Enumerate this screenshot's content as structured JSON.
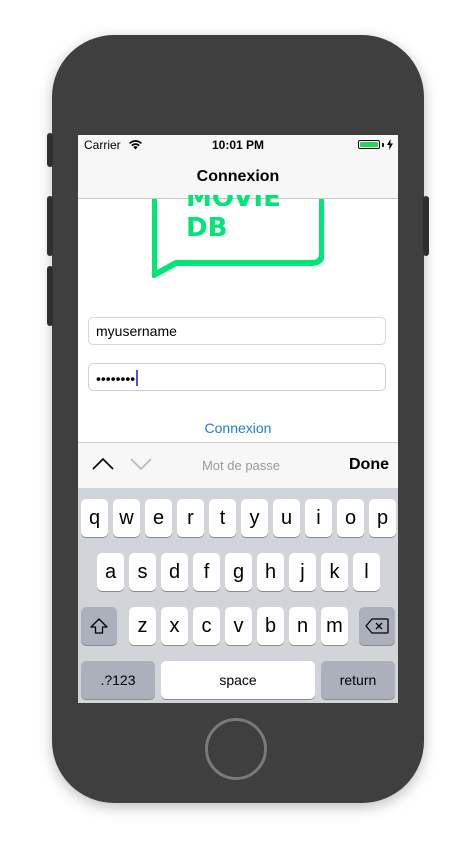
{
  "status_bar": {
    "carrier": "Carrier",
    "time": "10:01 PM"
  },
  "nav": {
    "title": "Connexion"
  },
  "logo": {
    "line1": "MOVIE",
    "line2": "DB",
    "color": "#00e676"
  },
  "form": {
    "username_value": "myusername",
    "password_dots": "••••••••",
    "login_label": "Connexion"
  },
  "toolbar": {
    "field_label": "Mot de passe",
    "done_label": "Done"
  },
  "keyboard": {
    "row1": [
      "q",
      "w",
      "e",
      "r",
      "t",
      "y",
      "u",
      "i",
      "o",
      "p"
    ],
    "row2": [
      "a",
      "s",
      "d",
      "f",
      "g",
      "h",
      "j",
      "k",
      "l"
    ],
    "row3": [
      "z",
      "x",
      "c",
      "v",
      "b",
      "n",
      "m"
    ],
    "numbers_label": ".?123",
    "space_label": "space",
    "return_label": "return",
    "shift_icon": "shift-icon",
    "delete_icon": "delete-icon"
  },
  "colors": {
    "accent": "#1a7ee6",
    "brand": "#00e676",
    "frame": "#3f3f3f"
  }
}
